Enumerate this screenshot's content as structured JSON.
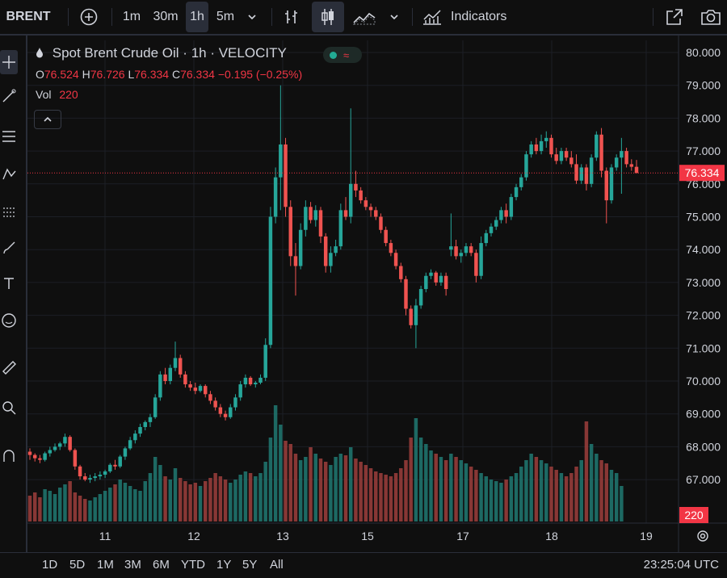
{
  "toolbar": {
    "symbol": "BRENT",
    "intervals": [
      "1m",
      "30m",
      "1h",
      "5m"
    ],
    "active_interval": "1h",
    "indicators_label": "Indicators"
  },
  "legend": {
    "title": "Spot Brent Crude Oil · 1h · VELOCITY",
    "o_label": "O",
    "o_value": "76.524",
    "h_label": "H",
    "h_value": "76.726",
    "l_label": "L",
    "l_value": "76.334",
    "c_label": "C",
    "c_value": "76.334",
    "change": "−0.195 (−0.25%)",
    "vol_label": "Vol",
    "vol_value": "220"
  },
  "price_axis": {
    "ticks": [
      "80.000",
      "79.000",
      "78.000",
      "77.000",
      "76.000",
      "75.000",
      "74.000",
      "73.000",
      "72.000",
      "71.000",
      "70.000",
      "69.000",
      "68.000",
      "67.000"
    ],
    "last_price": "76.334",
    "last_volume": "220"
  },
  "time_axis": {
    "labels": [
      "11",
      "12",
      "13",
      "15",
      "17",
      "18",
      "19"
    ]
  },
  "bottom": {
    "ranges": [
      "1D",
      "5D",
      "1M",
      "3M",
      "6M",
      "YTD",
      "1Y",
      "5Y",
      "All"
    ],
    "clock": "23:25:04 UTC"
  },
  "colors": {
    "up": "#26a69a",
    "down": "#ef5350",
    "background": "#0f0f0f",
    "grid": "#1c1f26",
    "price_line": "#f23645"
  },
  "chart_data": {
    "type": "candlestick",
    "title": "Spot Brent Crude Oil · 1h · VELOCITY",
    "ylim": [
      66.0,
      80.2
    ],
    "y_ticks": [
      67,
      68,
      69,
      70,
      71,
      72,
      73,
      74,
      75,
      76,
      77,
      78,
      79,
      80
    ],
    "x_labels": [
      "11",
      "12",
      "13",
      "15",
      "17",
      "18",
      "19"
    ],
    "last_price": 76.334,
    "ohlc": [
      [
        67.85,
        67.95,
        67.6,
        67.75
      ],
      [
        67.75,
        67.8,
        67.55,
        67.65
      ],
      [
        67.65,
        67.75,
        67.5,
        67.6
      ],
      [
        67.6,
        67.85,
        67.55,
        67.8
      ],
      [
        67.8,
        68.0,
        67.7,
        67.9
      ],
      [
        67.9,
        68.1,
        67.85,
        68.0
      ],
      [
        68.0,
        68.15,
        67.9,
        68.1
      ],
      [
        68.1,
        68.4,
        68.0,
        68.3
      ],
      [
        68.3,
        68.35,
        67.85,
        67.9
      ],
      [
        67.9,
        67.95,
        67.3,
        67.4
      ],
      [
        67.4,
        67.45,
        67.0,
        67.1
      ],
      [
        67.1,
        67.2,
        66.95,
        67.0
      ],
      [
        67.0,
        67.15,
        66.9,
        67.05
      ],
      [
        67.05,
        67.2,
        66.95,
        67.1
      ],
      [
        67.1,
        67.25,
        67.0,
        67.15
      ],
      [
        67.15,
        67.3,
        67.05,
        67.25
      ],
      [
        67.25,
        67.5,
        67.2,
        67.45
      ],
      [
        67.45,
        67.6,
        67.3,
        67.4
      ],
      [
        67.4,
        67.75,
        67.35,
        67.7
      ],
      [
        67.7,
        68.0,
        67.6,
        67.95
      ],
      [
        67.95,
        68.3,
        67.9,
        68.2
      ],
      [
        68.2,
        68.5,
        68.1,
        68.4
      ],
      [
        68.4,
        68.7,
        68.3,
        68.6
      ],
      [
        68.6,
        68.8,
        68.5,
        68.75
      ],
      [
        68.75,
        69.0,
        68.6,
        68.9
      ],
      [
        68.9,
        69.6,
        68.85,
        69.5
      ],
      [
        69.5,
        70.3,
        69.4,
        70.2
      ],
      [
        70.2,
        70.4,
        69.9,
        70.0
      ],
      [
        70.0,
        70.5,
        69.9,
        70.4
      ],
      [
        70.4,
        71.2,
        70.3,
        70.7
      ],
      [
        70.7,
        70.8,
        70.1,
        70.2
      ],
      [
        70.2,
        70.3,
        69.8,
        69.9
      ],
      [
        69.9,
        70.0,
        69.7,
        69.8
      ],
      [
        69.8,
        69.95,
        69.6,
        69.7
      ],
      [
        69.7,
        69.9,
        69.65,
        69.85
      ],
      [
        69.85,
        69.9,
        69.5,
        69.6
      ],
      [
        69.6,
        69.7,
        69.3,
        69.4
      ],
      [
        69.4,
        69.5,
        69.1,
        69.2
      ],
      [
        69.2,
        69.3,
        68.9,
        69.0
      ],
      [
        69.0,
        69.1,
        68.8,
        68.9
      ],
      [
        68.9,
        69.3,
        68.85,
        69.2
      ],
      [
        69.2,
        69.6,
        69.1,
        69.5
      ],
      [
        69.5,
        70.0,
        69.4,
        69.9
      ],
      [
        69.9,
        70.2,
        69.8,
        70.1
      ],
      [
        70.1,
        70.15,
        69.85,
        69.9
      ],
      [
        69.9,
        70.0,
        69.8,
        69.95
      ],
      [
        69.95,
        70.2,
        69.9,
        70.1
      ],
      [
        70.1,
        71.3,
        70.0,
        71.1
      ],
      [
        71.1,
        75.3,
        71.0,
        75.0
      ],
      [
        75.0,
        76.5,
        74.8,
        76.2
      ],
      [
        76.2,
        79.0,
        75.2,
        77.2
      ],
      [
        77.2,
        77.4,
        75.0,
        75.3
      ],
      [
        75.3,
        75.5,
        73.5,
        73.8
      ],
      [
        73.8,
        74.2,
        72.6,
        73.5
      ],
      [
        73.5,
        74.8,
        73.4,
        74.6
      ],
      [
        74.6,
        75.5,
        74.4,
        75.3
      ],
      [
        75.3,
        75.45,
        74.8,
        74.9
      ],
      [
        74.9,
        75.35,
        74.7,
        75.2
      ],
      [
        75.2,
        75.3,
        74.2,
        74.4
      ],
      [
        74.4,
        74.5,
        73.3,
        73.5
      ],
      [
        73.5,
        74.1,
        73.3,
        73.9
      ],
      [
        73.9,
        74.3,
        73.8,
        74.1
      ],
      [
        74.1,
        75.4,
        74.0,
        75.2
      ],
      [
        75.2,
        75.6,
        74.9,
        75.0
      ],
      [
        75.0,
        78.3,
        74.8,
        76.0
      ],
      [
        76.0,
        76.4,
        75.6,
        75.8
      ],
      [
        75.8,
        75.9,
        75.4,
        75.5
      ],
      [
        75.5,
        75.6,
        75.2,
        75.3
      ],
      [
        75.3,
        75.4,
        75.0,
        75.2
      ],
      [
        75.2,
        75.3,
        74.9,
        75.0
      ],
      [
        75.0,
        75.1,
        74.5,
        74.6
      ],
      [
        74.6,
        74.7,
        74.1,
        74.2
      ],
      [
        74.2,
        74.3,
        73.8,
        73.9
      ],
      [
        73.9,
        74.0,
        73.4,
        73.5
      ],
      [
        73.5,
        73.6,
        73.0,
        73.1
      ],
      [
        73.1,
        73.2,
        72.0,
        72.2
      ],
      [
        72.2,
        72.3,
        71.6,
        71.7
      ],
      [
        71.7,
        72.5,
        71.0,
        72.3
      ],
      [
        72.3,
        72.9,
        72.2,
        72.8
      ],
      [
        72.8,
        73.3,
        72.7,
        73.2
      ],
      [
        73.2,
        73.4,
        73.1,
        73.3
      ],
      [
        73.3,
        73.35,
        72.9,
        73.0
      ],
      [
        73.0,
        73.3,
        72.9,
        73.2
      ],
      [
        73.2,
        73.3,
        72.6,
        72.8
      ],
      [
        74.0,
        75.1,
        73.8,
        74.1
      ],
      [
        74.1,
        74.3,
        73.7,
        73.8
      ],
      [
        73.8,
        74.0,
        73.6,
        73.9
      ],
      [
        73.9,
        74.2,
        73.8,
        74.1
      ],
      [
        74.1,
        74.2,
        73.8,
        73.9
      ],
      [
        73.9,
        74.0,
        73.0,
        73.2
      ],
      [
        73.2,
        74.4,
        73.1,
        74.2
      ],
      [
        74.2,
        74.6,
        74.1,
        74.5
      ],
      [
        74.5,
        74.8,
        74.4,
        74.7
      ],
      [
        74.7,
        75.0,
        74.6,
        74.9
      ],
      [
        74.9,
        75.3,
        74.8,
        75.2
      ],
      [
        75.2,
        75.4,
        74.8,
        75.0
      ],
      [
        75.0,
        75.7,
        74.9,
        75.6
      ],
      [
        75.6,
        76.0,
        75.5,
        75.9
      ],
      [
        75.9,
        76.3,
        75.8,
        76.2
      ],
      [
        76.2,
        77.0,
        76.1,
        76.9
      ],
      [
        76.9,
        77.3,
        76.8,
        77.2
      ],
      [
        77.2,
        77.4,
        76.9,
        77.0
      ],
      [
        77.0,
        77.5,
        76.9,
        77.3
      ],
      [
        77.3,
        77.6,
        77.1,
        77.4
      ],
      [
        77.4,
        77.5,
        76.8,
        76.9
      ],
      [
        76.9,
        77.1,
        76.6,
        76.7
      ],
      [
        76.7,
        77.1,
        76.6,
        77.0
      ],
      [
        77.0,
        77.1,
        76.7,
        76.8
      ],
      [
        76.8,
        77.0,
        76.5,
        76.6
      ],
      [
        76.6,
        76.9,
        76.0,
        76.1
      ],
      [
        76.1,
        76.6,
        76.0,
        76.5
      ],
      [
        76.5,
        76.6,
        75.8,
        76.0
      ],
      [
        76.0,
        76.9,
        75.9,
        76.8
      ],
      [
        76.8,
        77.6,
        76.7,
        77.5
      ],
      [
        77.5,
        77.7,
        76.2,
        76.4
      ],
      [
        76.4,
        76.5,
        74.8,
        75.5
      ],
      [
        75.5,
        76.6,
        75.4,
        76.5
      ],
      [
        76.5,
        76.9,
        76.4,
        76.8
      ],
      [
        76.8,
        77.4,
        75.7,
        77.0
      ],
      [
        77.0,
        77.1,
        76.5,
        76.6
      ],
      [
        76.6,
        76.75,
        76.4,
        76.52
      ],
      [
        76.52,
        76.73,
        76.33,
        76.33
      ]
    ],
    "volume": [
      160,
      180,
      150,
      200,
      190,
      170,
      210,
      230,
      250,
      180,
      160,
      140,
      130,
      150,
      170,
      190,
      210,
      230,
      260,
      240,
      220,
      200,
      190,
      250,
      300,
      400,
      350,
      280,
      260,
      330,
      270,
      250,
      230,
      240,
      220,
      250,
      270,
      300,
      280,
      260,
      240,
      260,
      290,
      310,
      300,
      280,
      300,
      370,
      520,
      720,
      600,
      500,
      480,
      420,
      380,
      400,
      460,
      420,
      390,
      370,
      350,
      400,
      420,
      410,
      460,
      390,
      370,
      350,
      330,
      310,
      300,
      290,
      280,
      300,
      330,
      380,
      520,
      640,
      520,
      480,
      440,
      420,
      400,
      380,
      420,
      400,
      380,
      360,
      340,
      320,
      300,
      280,
      260,
      250,
      240,
      260,
      280,
      300,
      340,
      380,
      420,
      400,
      380,
      360,
      340,
      320,
      300,
      280,
      300,
      340,
      380,
      620,
      480,
      420,
      380,
      360,
      320,
      300,
      220
    ],
    "volume_colors": "follows candle direction"
  }
}
